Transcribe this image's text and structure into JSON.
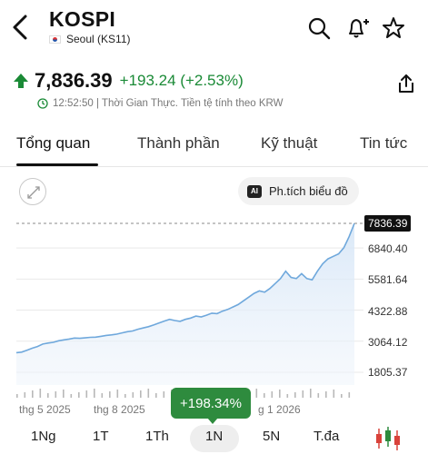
{
  "header": {
    "title": "KOSPI",
    "exchange": "Seoul (KS11)",
    "icons": [
      "back-icon",
      "search-icon",
      "bell-plus-icon",
      "star-icon"
    ]
  },
  "quote": {
    "price": "7,836.39",
    "change": "+193.24 (+2.53%)",
    "meta": "12:52:50 | Thời Gian Thực. Tiền tệ tính theo KRW",
    "up_color": "#1a8a36"
  },
  "tabs": [
    "Tổng quan",
    "Thành phần",
    "Kỹ thuật",
    "Tin tức"
  ],
  "chart_controls": {
    "ai_badge": "AI",
    "ai_button": "Ph.tích biểu đồ"
  },
  "chart_data": {
    "type": "area",
    "y_ticks": [
      "7836.39",
      "6840.40",
      "5581.64",
      "4322.88",
      "3064.12",
      "1805.37"
    ],
    "current_value": "7836.39",
    "x_labels": [
      "thg 5 2025",
      "thg 8 2025",
      "g 1 2026"
    ],
    "series": [
      {
        "values": [
          2600,
          2620,
          2700,
          2780,
          2850,
          2950,
          2990,
          3020,
          3080,
          3120,
          3150,
          3190,
          3180,
          3200,
          3220,
          3230,
          3260,
          3300,
          3320,
          3350,
          3400,
          3450,
          3480,
          3550,
          3600,
          3650,
          3720,
          3800,
          3880,
          3950,
          3900,
          3870,
          3950,
          4000,
          4080,
          4050,
          4120,
          4200,
          4180,
          4280,
          4350,
          4450,
          4550,
          4700,
          4850,
          5000,
          5100,
          5050,
          5200,
          5400,
          5600,
          5900,
          5650,
          5600,
          5800,
          5600,
          5550,
          5900,
          6200,
          6400,
          6500,
          6600,
          6850,
          7300,
          7836.39
        ],
        "color": "#6fa8dc"
      }
    ],
    "change_label": "+198.34%"
  },
  "periods": [
    "1Ng",
    "1T",
    "1Th",
    "1N",
    "5N",
    "T.đa"
  ],
  "active_period": "1N"
}
